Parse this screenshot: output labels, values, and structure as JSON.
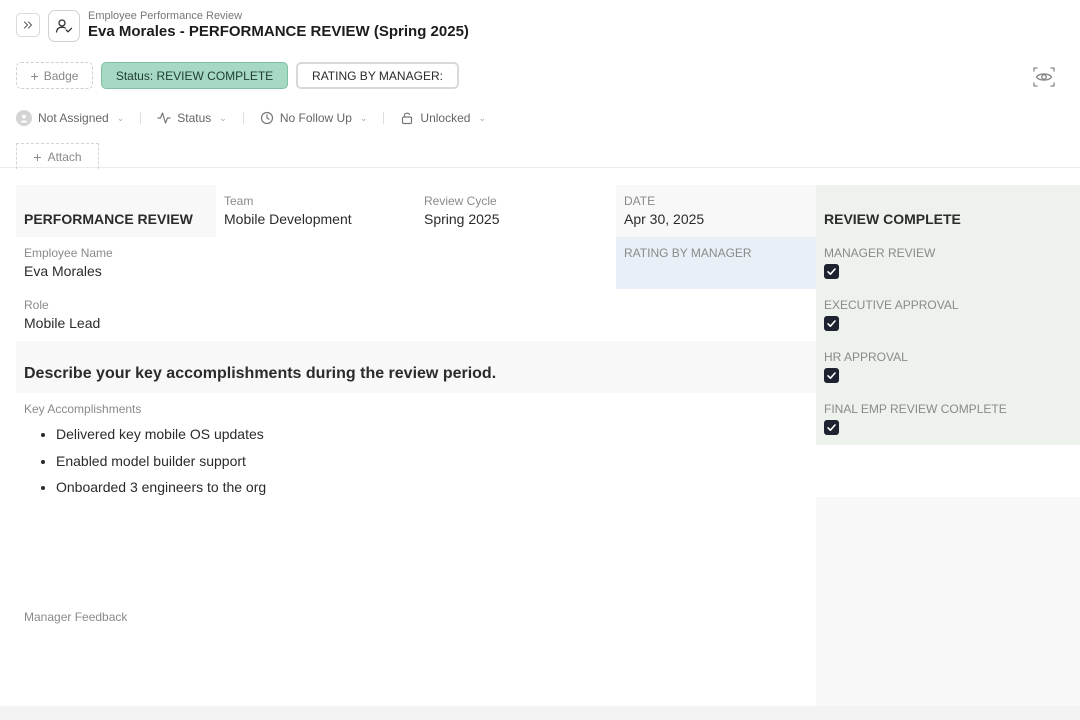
{
  "header": {
    "breadcrumb": "Employee Performance Review",
    "title": "Eva Morales - PERFORMANCE REVIEW (Spring 2025)"
  },
  "badges": {
    "add_label": "Badge",
    "status_label": "Status: REVIEW COMPLETE",
    "rating_label": "RATING BY MANAGER:"
  },
  "properties": {
    "assignee": "Not Assigned",
    "status": "Status",
    "follow_up": "No Follow Up",
    "lock": "Unlocked"
  },
  "attach_label": "Attach",
  "form": {
    "section_title": "PERFORMANCE REVIEW",
    "team": {
      "label": "Team",
      "value": "Mobile Development"
    },
    "review_cycle": {
      "label": "Review Cycle",
      "value": "Spring 2025"
    },
    "date": {
      "label": "DATE",
      "value": "Apr 30, 2025"
    },
    "employee_name": {
      "label": "Employee Name",
      "value": "Eva Morales"
    },
    "rating_by_manager": {
      "label": "RATING BY MANAGER",
      "value": ""
    },
    "role": {
      "label": "Role",
      "value": "Mobile Lead"
    },
    "accomplishments_prompt": "Describe your key accomplishments during the review period.",
    "accomplishments_label": "Key Accomplishments",
    "accomplishments": [
      "Delivered key mobile OS updates",
      "Enabled model builder support",
      "Onboarded 3 engineers to the org"
    ],
    "manager_feedback_label": "Manager Feedback"
  },
  "approvals": {
    "title": "REVIEW COMPLETE",
    "items": [
      {
        "label": "MANAGER REVIEW",
        "checked": true
      },
      {
        "label": "EXECUTIVE APPROVAL",
        "checked": true
      },
      {
        "label": "HR APPROVAL",
        "checked": true
      },
      {
        "label": "FINAL EMP REVIEW COMPLETE",
        "checked": true
      }
    ]
  },
  "colors": {
    "status_green": "#a6d9c3",
    "approvals_panel": "#edf2ec",
    "rating_panel": "#e9eff6",
    "checkbox": "#1e2230"
  },
  "icons": {
    "expand": "chevrons-right-icon",
    "record": "user-check-icon",
    "view": "eye-icon",
    "assignee": "user-icon",
    "status": "activity-icon",
    "follow_up": "clock-icon",
    "lock": "lock-icon",
    "add": "plus-icon",
    "check": "check-icon"
  }
}
